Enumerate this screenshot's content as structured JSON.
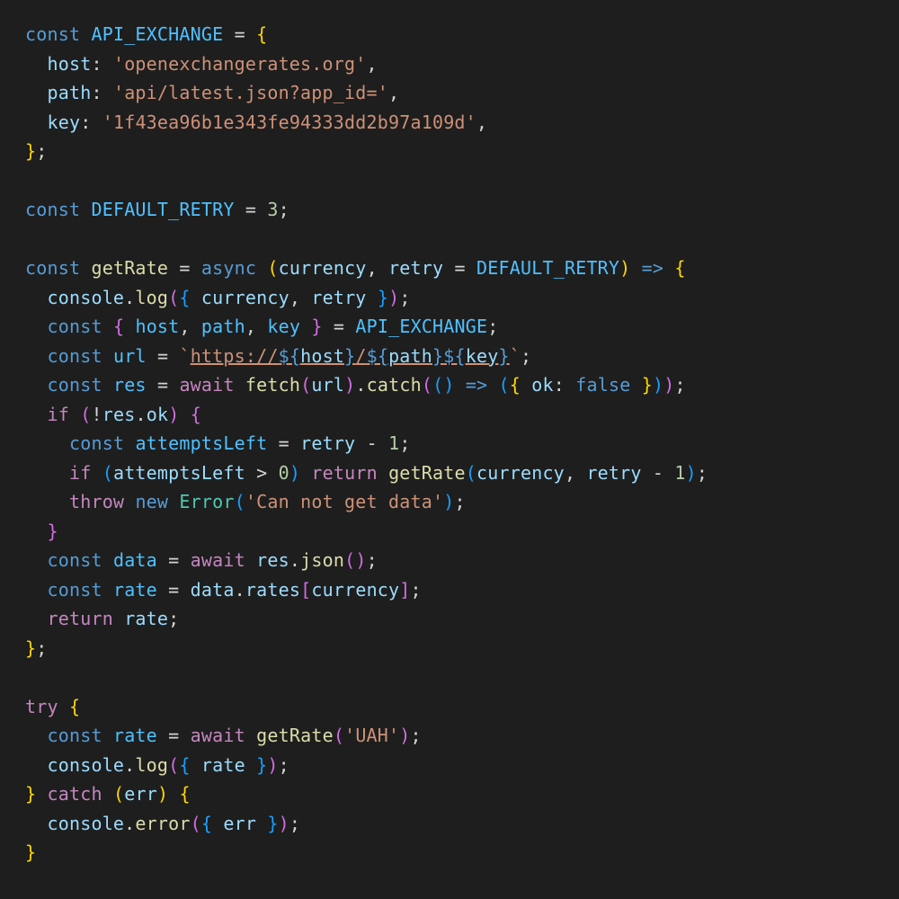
{
  "code": {
    "tokens": {
      "const": "const",
      "async": "async",
      "await": "await",
      "return": "return",
      "if": "if",
      "throw": "throw",
      "new": "new",
      "try": "try",
      "catch": "catch",
      "arrow": "=>"
    },
    "idents": {
      "API_EXCHANGE": "API_EXCHANGE",
      "host": "host",
      "path": "path",
      "key": "key",
      "DEFAULT_RETRY": "DEFAULT_RETRY",
      "getRate": "getRate",
      "currency": "currency",
      "retry": "retry",
      "console": "console",
      "log": "log",
      "error": "error",
      "url": "url",
      "res": "res",
      "fetch": "fetch",
      "catchFn": "catch",
      "ok": "ok",
      "attemptsLeft": "attemptsLeft",
      "Error": "Error",
      "data": "data",
      "json": "json",
      "rate": "rate",
      "rates": "rates",
      "err": "err",
      "false": "false"
    },
    "strings": {
      "hostVal": "'openexchangerates.org'",
      "pathVal": "'api/latest.json?app_id='",
      "keyVal": "'1f43ea96b1e343fe94333dd2b97a109d'",
      "https": "https://",
      "slash": "/",
      "errMsg": "'Can not get data'",
      "uah": "'UAH'",
      "backtick": "`"
    },
    "nums": {
      "three": "3",
      "one": "1",
      "zero": "0"
    }
  }
}
